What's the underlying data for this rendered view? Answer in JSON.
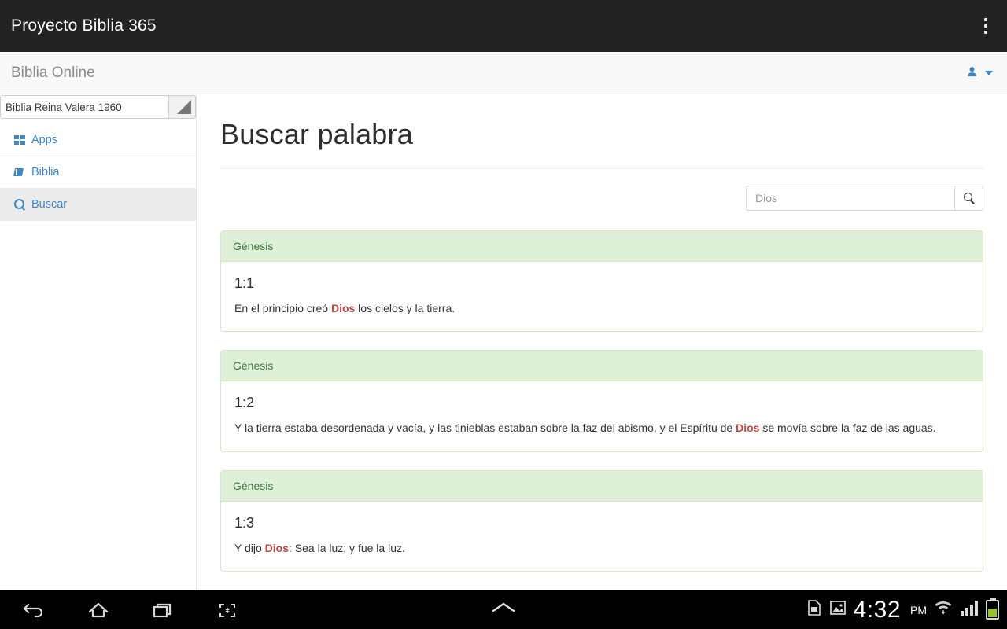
{
  "android": {
    "app_title": "Proyecto Biblia 365",
    "overflow_menu_icon": "more-vert-icon",
    "nav": {
      "back_icon": "back-arrow-icon",
      "home_icon": "home-icon",
      "recents_icon": "recent-apps-icon",
      "screenshot_icon": "screenshot-icon",
      "expand_icon": "chevron-up-icon"
    },
    "status": {
      "sim_icon": "sim-card-alert-icon",
      "image_icon": "screenshot-saved-icon",
      "time": "4:32",
      "meridiem": "PM",
      "wifi_icon": "wifi-icon",
      "signal_icon": "signal-bars-icon",
      "battery_icon": "battery-icon"
    }
  },
  "navbar": {
    "brand": "Biblia Online",
    "user_icon": "user-icon",
    "caret_icon": "chevron-down-icon"
  },
  "sidebar": {
    "version_select": {
      "value": "Biblia Reina Valera 1960",
      "grip_icon": "resize-handle-icon"
    },
    "items": [
      {
        "label": "Apps",
        "icon": "grid-icon",
        "active": false
      },
      {
        "label": "Biblia",
        "icon": "book-icon",
        "active": false
      },
      {
        "label": "Buscar",
        "icon": "search-icon",
        "active": true
      }
    ]
  },
  "main": {
    "page_title": "Buscar palabra",
    "search": {
      "value": "",
      "placeholder": "Dios",
      "button_icon": "search-icon"
    },
    "results": [
      {
        "book": "Génesis",
        "reference": "1:1",
        "parts": [
          {
            "text": "En el principio creó ",
            "highlight": false
          },
          {
            "text": "Dios",
            "highlight": true
          },
          {
            "text": " los cielos y la tierra.",
            "highlight": false
          }
        ]
      },
      {
        "book": "Génesis",
        "reference": "1:2",
        "parts": [
          {
            "text": "Y la tierra estaba desordenada y vacía, y las tinieblas estaban sobre la faz del abismo, y el Espíritu de ",
            "highlight": false
          },
          {
            "text": "Dios",
            "highlight": true
          },
          {
            "text": " se movía sobre la faz de las aguas.",
            "highlight": false
          }
        ]
      },
      {
        "book": "Génesis",
        "reference": "1:3",
        "parts": [
          {
            "text": "Y dijo ",
            "highlight": false
          },
          {
            "text": "Dios",
            "highlight": true
          },
          {
            "text": ": Sea la luz; y fue la luz.",
            "highlight": false
          }
        ]
      }
    ]
  },
  "colors": {
    "appbar_bg": "#232323",
    "link_blue": "#3e87cb",
    "panel_head_bg": "#dff0d8",
    "panel_head_text": "#3c763d",
    "panel_border": "#d6e9c6",
    "highlight_red": "#b94a48",
    "battery_green": "#95c230"
  }
}
